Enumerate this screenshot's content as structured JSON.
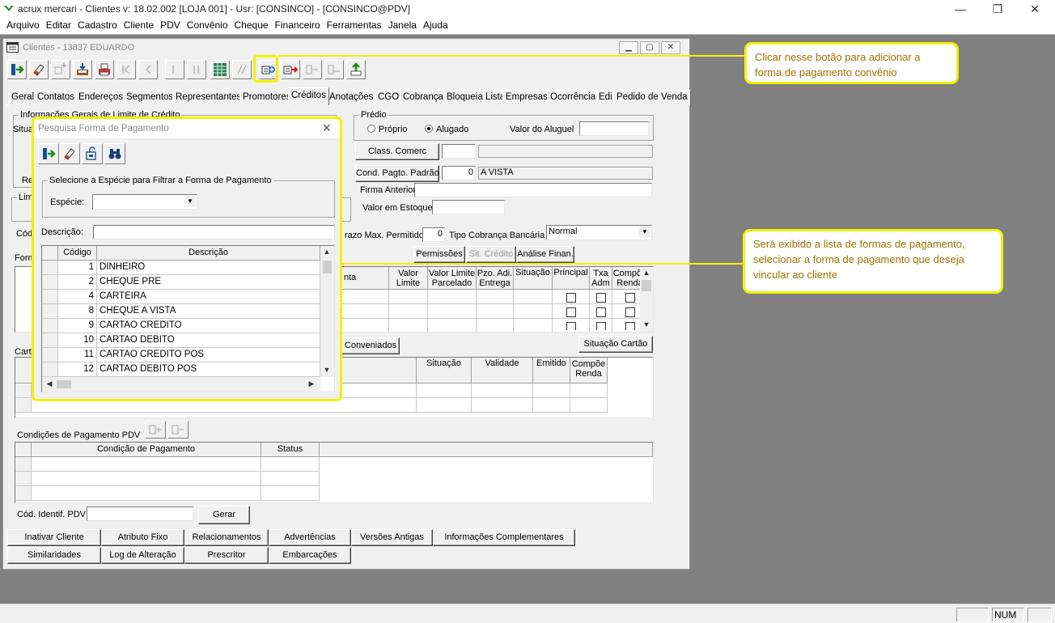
{
  "window": {
    "title": "acrux mercari - Clientes  v: 18.02.002   [LOJA 001]  - Usr: [CONSINCO] - [CONSINCO@PDV]",
    "minimize": "—",
    "maximize": "❐",
    "close": "✕"
  },
  "menu": [
    "Arquivo",
    "Editar",
    "Cadastro",
    "Cliente",
    "PDV",
    "Convênio",
    "Cheque",
    "Financeiro",
    "Ferramentas",
    "Janela",
    "Ajuda"
  ],
  "status": {
    "num": "NUM"
  },
  "child": {
    "title": "Clientes - 13837 EDUARDO",
    "toolbar": [
      "exit-icon",
      "eraser-icon",
      "add-disabled-icon",
      "save-icon",
      "print-icon",
      "first-icon",
      "prev-icon",
      "next-icon",
      "last-icon",
      "table-icon",
      "edit-disabled-icon",
      "add-convenio-icon",
      "remove-convenio-icon",
      "disabled-a-icon",
      "disabled-b-icon",
      "export-icon"
    ],
    "tabs": [
      "Geral",
      "Contatos",
      "Endereços",
      "Segmentos",
      "Representantes",
      "Promotores",
      "Créditos",
      "Anotações",
      "CGO",
      "Cobrança",
      "Bloqueia Lista",
      "Empresas",
      "Ocorrência",
      "Edi",
      "Pedido de Venda"
    ],
    "active_tab": "Créditos"
  },
  "credits": {
    "info_group": "Informações Gerais de Limite de Crédito",
    "situ_label": "Situa",
    "re_label": "Re",
    "lim_label": "Lim",
    "cod_label": "Cód",
    "form_label": "Form",
    "cart_label": "Cart",
    "predio": {
      "legend": "Prédio",
      "proprio": "Próprio",
      "alugado": "Alugado",
      "valor_aluguel_label": "Valor do Aluguel",
      "valor_aluguel": ""
    },
    "class_comerc": {
      "label": "Class. Comerc",
      "code": "",
      "desc": ""
    },
    "cond_pagto": {
      "label": "Cond. Pagto. Padrão",
      "code": "0",
      "desc": "A VISTA"
    },
    "firma_anterior_label": "Firma Anterior",
    "firma_anterior": "",
    "valor_estoque_label": "Valor em Estoque",
    "valor_estoque": "",
    "prazo_label": "razo Max. Permitido",
    "prazo_value": "0",
    "tipo_cobranca_label": "Tipo Cobrança Bancária",
    "tipo_cobranca": "Normal",
    "buttons": {
      "permissoes": "Permissões",
      "sit_credito": "Sit. Crédito",
      "analise": "Análise Finan."
    },
    "forma_grid": {
      "headers": [
        "nta",
        "Valor Limite",
        "Valor Limite Parcelado",
        "Pzo. Adi. Entrega",
        "Situação",
        "Principal",
        "Txa Adm",
        "Compõe Renda"
      ]
    },
    "conveniados_btn": "Conveniados",
    "situacao_cartao_btn": "Situação Cartão",
    "cartao_grid": {
      "headers": [
        "Situação",
        "Validade",
        "Emitido",
        "Compõe Renda"
      ]
    },
    "pdv": {
      "label": "Condições de Pagamento PDV",
      "headers": [
        "Condição de Pagamento",
        "Status"
      ]
    },
    "cod_identif_label": "Cód. Identif. PDV",
    "cod_identif": "",
    "gerar_btn": "Gerar",
    "bottom_buttons_row1": [
      "Inativar Cliente",
      "Atributo Fixo",
      "Relacionamentos",
      "Advertências",
      "Versões Antigas",
      "Informações Complementares"
    ],
    "bottom_buttons_row2": [
      "Similaridades",
      "Log de Alteração",
      "Prescritor",
      "Embarcações"
    ]
  },
  "dialog": {
    "title": "Pesquisa Forma de Pagamento",
    "close": "✕",
    "toolbar": [
      "exit-icon",
      "eraser-icon",
      "unlock-icon",
      "binoculars-icon"
    ],
    "filter_group": "Selecione a Espécie para Filtrar a Forma de Pagamento",
    "especie_label": "Espécie:",
    "especie_value": "",
    "descricao_label": "Descrição:",
    "descricao_value": "",
    "headers": [
      "Código",
      "Descrição"
    ],
    "rows": [
      {
        "code": "1",
        "desc": "DINHEIRO"
      },
      {
        "code": "2",
        "desc": "CHEQUE PRE"
      },
      {
        "code": "4",
        "desc": "CARTEIRA"
      },
      {
        "code": "8",
        "desc": "CHEQUE A VISTA"
      },
      {
        "code": "9",
        "desc": "CARTAO CREDITO"
      },
      {
        "code": "10",
        "desc": "CARTAO DEBITO"
      },
      {
        "code": "11",
        "desc": "CARTAO CREDITO POS"
      },
      {
        "code": "12",
        "desc": "CARTAO DEBITO POS"
      }
    ]
  },
  "callouts": {
    "top": "Clicar nesse botão para adicionar a forma de pagamento convênio",
    "middle": "Será exibido a lista de formas de pagamento, selecionar a forma de pagamento que deseja vincular ao cliente"
  },
  "colors": {
    "highlight": "#f2f200",
    "callout_text": "#a07000",
    "mdi_bg": "#808080"
  }
}
